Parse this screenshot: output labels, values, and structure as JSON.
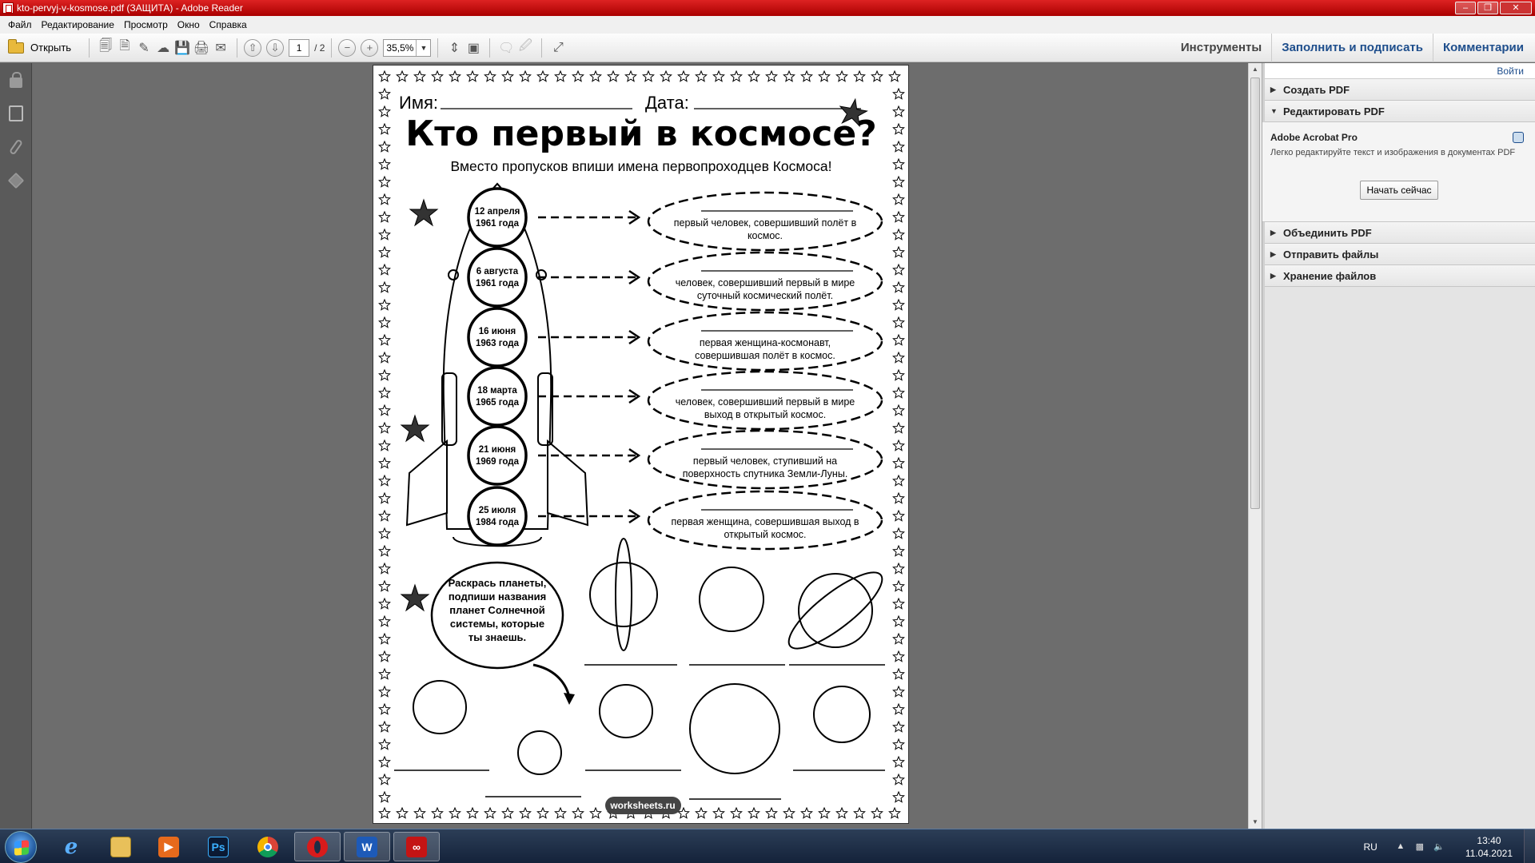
{
  "window": {
    "title": "kto-pervyj-v-kosmose.pdf (ЗАЩИТА) - Adobe Reader"
  },
  "menu": [
    "Файл",
    "Редактирование",
    "Просмотр",
    "Окно",
    "Справка"
  ],
  "toolbar": {
    "open_label": "Открыть",
    "page_current": "1",
    "page_total": "/ 2",
    "zoom": "35,5%",
    "tools_label": "Инструменты",
    "fill_sign_label": "Заполнить и подписать",
    "comments_label": "Комментарии"
  },
  "right_panel": {
    "login_label": "Войти",
    "sections": [
      {
        "label": "Создать PDF",
        "expanded": false
      },
      {
        "label": "Редактировать PDF",
        "expanded": true
      },
      {
        "label": "Объединить PDF",
        "expanded": false
      },
      {
        "label": "Отправить файлы",
        "expanded": false
      },
      {
        "label": "Хранение файлов",
        "expanded": false
      }
    ],
    "promo": {
      "title": "Adobe Acrobat Pro",
      "description": "Легко редактируйте текст и изображения в документах PDF",
      "button": "Начать сейчас"
    }
  },
  "document": {
    "name_label": "Имя:",
    "date_label": "Дата:",
    "heading": "Кто первый в космосе?",
    "subheading": "Вместо пропусков впиши имена первопроходцев Космоса!",
    "events": [
      {
        "date1": "12 апреля",
        "date2": "1961 года",
        "desc1": "первый человек, совершивший полёт в",
        "desc2": "космос."
      },
      {
        "date1": "6 августа",
        "date2": "1961 года",
        "desc1": "человек, совершивший первый в мире",
        "desc2": "суточный космический полёт."
      },
      {
        "date1": "16 июня",
        "date2": "1963 года",
        "desc1": "первая женщина-космонавт,",
        "desc2": "совершившая полёт в космос."
      },
      {
        "date1": "18 марта",
        "date2": "1965 года",
        "desc1": "человек, совершивший первый в мире",
        "desc2": "выход в открытый космос."
      },
      {
        "date1": "21 июня",
        "date2": "1969 года",
        "desc1": "первый человек, ступивший на",
        "desc2": "поверхность спутника Земли-Луны."
      },
      {
        "date1": "25 июля",
        "date2": "1984 года",
        "desc1": "первая женщина, совершившая выход в",
        "desc2": "открытый космос."
      }
    ],
    "bubble_lines": [
      "Раскрась планеты,",
      "подпиши названия",
      "планет Солнечной",
      "системы, которые",
      "ты знаешь."
    ],
    "footer": "worksheets.ru"
  },
  "taskbar": {
    "apps": [
      "ie-icon",
      "explorer-icon",
      "media-player-icon",
      "photoshop-icon",
      "chrome-icon",
      "opera-icon",
      "word-icon",
      "adobe-reader-icon"
    ],
    "photoshop_label": "Ps",
    "word_label": "W",
    "lang": "RU",
    "time": "13:40",
    "date": "11.04.2021"
  },
  "colors": {
    "titlebar": "#c41414",
    "accent_link": "#1e4e8c",
    "taskbar": "#1d2d46"
  }
}
